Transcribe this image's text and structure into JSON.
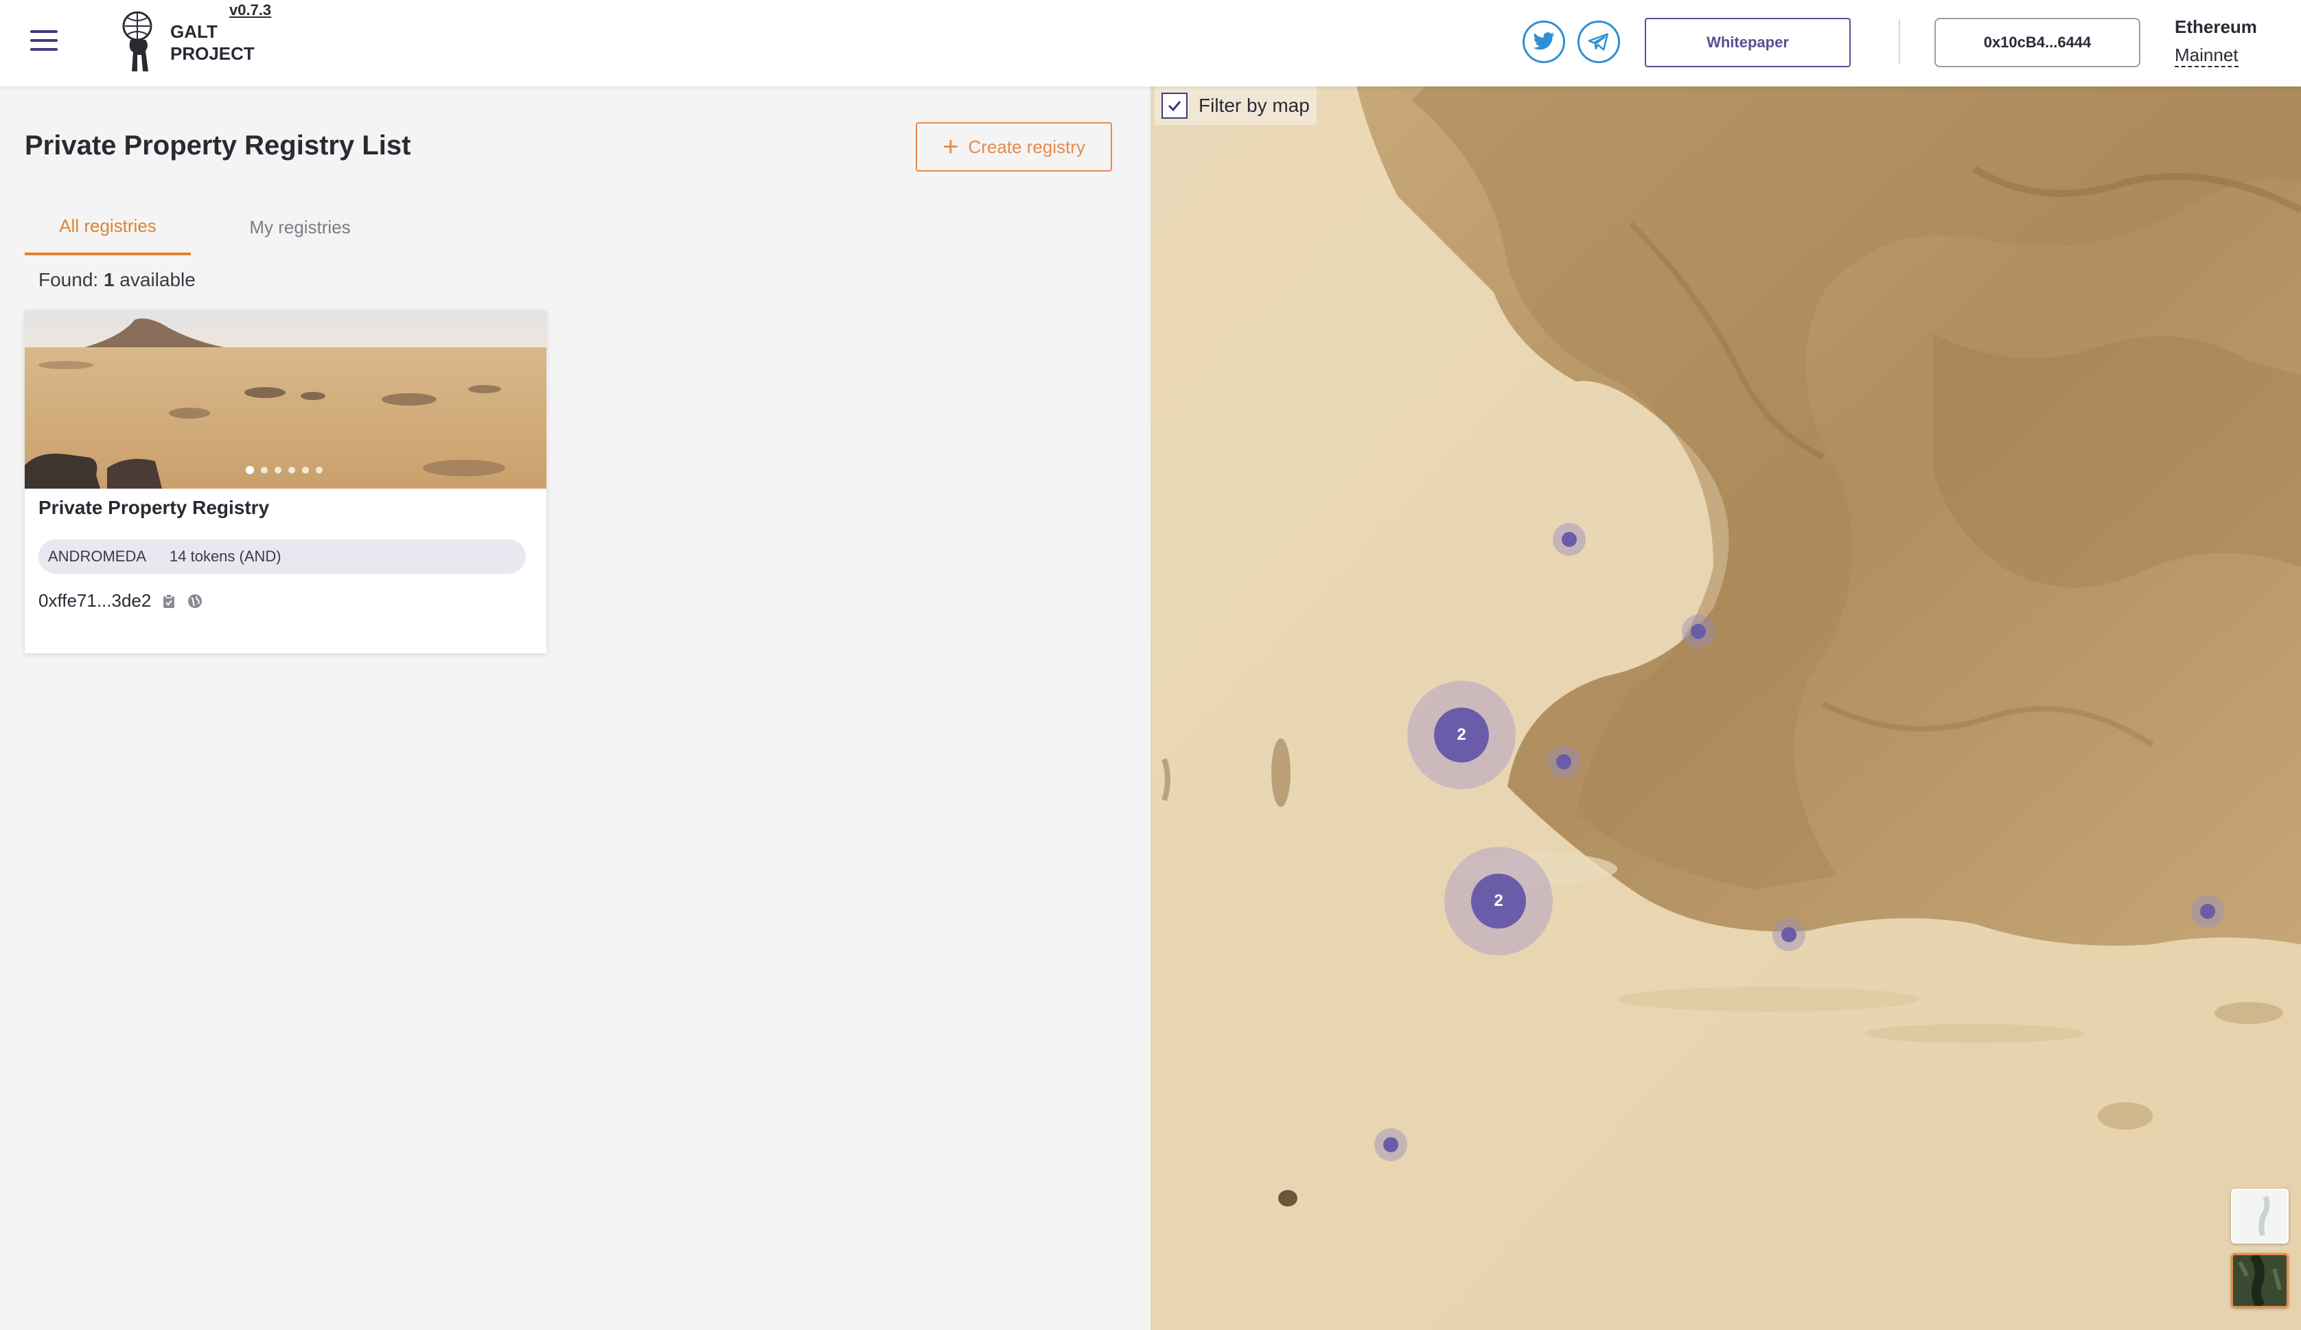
{
  "header": {
    "logo_line1": "GALT",
    "logo_line2": "PROJECT",
    "version": "v0.7.3",
    "whitepaper_label": "Whitepaper",
    "wallet_address": "0x10cB4...6444",
    "network_line1": "Ethereum",
    "network_line2": "Mainnet",
    "icons": [
      "menu-icon",
      "twitter-icon",
      "telegram-icon"
    ]
  },
  "main": {
    "title": "Private Property Registry List",
    "create_label": "Create registry",
    "tabs": [
      {
        "label": "All registries",
        "active": true
      },
      {
        "label": "My registries",
        "active": false
      }
    ],
    "found_prefix": "Found: ",
    "found_count": "1",
    "found_suffix": " available",
    "registries": [
      {
        "title": "Private Property Registry",
        "ticker": "ANDROMEDA",
        "tokens": "14 tokens (AND)",
        "address": "0xffe71...3de2",
        "image_count": 6,
        "active_image": 0
      }
    ]
  },
  "map": {
    "filter_label": "Filter by map",
    "filter_checked": true,
    "clusters": [
      {
        "count": "2"
      },
      {
        "count": "2"
      }
    ],
    "layer_options": [
      "map",
      "satellite"
    ]
  },
  "colors": {
    "accent": "#e08431",
    "primary": "#5a4f93",
    "marker": "#6a5ca8",
    "social": "#2d8fd5"
  }
}
